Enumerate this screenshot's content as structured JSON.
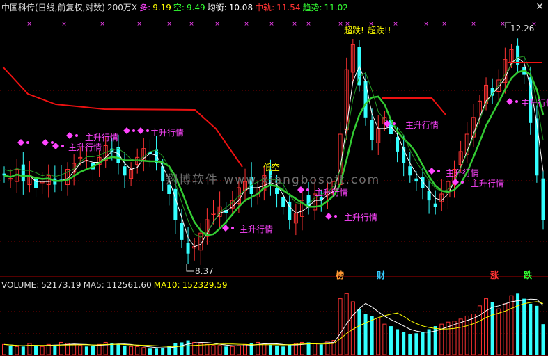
{
  "header": {
    "stock": "中国科传(日线,前复权,对数)",
    "volume_unit": "200万X",
    "duo_label": "多:",
    "duo_value": "9.19",
    "kong_label": "空:",
    "kong_value": "9.49",
    "junheng_label": "均衡:",
    "junheng_value": "10.08",
    "zhonggui_label": "中轨:",
    "zhonggui_value": "11.54",
    "qushi_label": "趋势:",
    "qushi_value": "11.02",
    "close_icon": "close-icon"
  },
  "volume_header": {
    "volume_label": "VOLUME:",
    "volume_value": "52173.19",
    "ma5_label": "MA5:",
    "ma5_value": "112561.60",
    "ma10_label": "MA10:",
    "ma10_value": "152329.59"
  },
  "price_labels": {
    "high": "12.26",
    "low": "8.37"
  },
  "watermark": "翔博软件 www.xiangbosoft.com",
  "annotations": {
    "zhusheng": "主升行情",
    "dixin": "低空",
    "chaodie": "超跌!",
    "top_text": "超跌!!"
  },
  "tags": {
    "bang": "榜",
    "cai": "财",
    "zhang": "涨",
    "die": "跌"
  },
  "colors": {
    "up": "#ff3333",
    "down": "#33ffff",
    "green": "#33cc33",
    "red": "#ee1111",
    "white": "#ffffff",
    "magenta": "#ff44ff",
    "yellow": "#ffff00"
  },
  "chart_data": {
    "type": "candlestick",
    "series_close": [
      9.6,
      9.55,
      9.7,
      9.5,
      9.6,
      9.4,
      9.5,
      9.6,
      9.45,
      9.5,
      9.7,
      9.8,
      9.9,
      9.85,
      9.7,
      9.9,
      10.1,
      10.0,
      9.8,
      9.6,
      9.7,
      9.9,
      10.05,
      9.95,
      9.8,
      9.5,
      9.3,
      8.9,
      8.6,
      8.4,
      8.5,
      8.7,
      8.9,
      9.0,
      9.1,
      9.0,
      9.2,
      9.4,
      9.5,
      9.3,
      9.4,
      9.6,
      9.45,
      9.3,
      9.1,
      8.9,
      9.0,
      9.2,
      9.1,
      9.3,
      9.2,
      9.35,
      9.5,
      10.3,
      11.5,
      12.0,
      11.2,
      10.6,
      10.2,
      10.4,
      10.6,
      10.3,
      10.0,
      9.8,
      9.6,
      9.5,
      9.4,
      9.2,
      9.1,
      9.3,
      9.5,
      9.7,
      10.0,
      10.3,
      10.6,
      10.9,
      11.2,
      11.0,
      11.3,
      11.7,
      11.9,
      11.6,
      11.4,
      10.5,
      9.6,
      8.9
    ],
    "volume": [
      10,
      9,
      8,
      8,
      11,
      9,
      8,
      10,
      9,
      12,
      11,
      10,
      9,
      8,
      9,
      10,
      12,
      11,
      10,
      9,
      8,
      8,
      7,
      6,
      6,
      7,
      8,
      11,
      12,
      14,
      12,
      11,
      10,
      9,
      9,
      8,
      8,
      9,
      10,
      11,
      12,
      11,
      10,
      9,
      8,
      10,
      11,
      12,
      12,
      11,
      10,
      13,
      14,
      55,
      60,
      52,
      45,
      40,
      38,
      36,
      30,
      28,
      25,
      22,
      20,
      21,
      22,
      25,
      28,
      30,
      32,
      33,
      35,
      38,
      40,
      48,
      55,
      52,
      45,
      50,
      58,
      60,
      55,
      50,
      48,
      30
    ]
  }
}
